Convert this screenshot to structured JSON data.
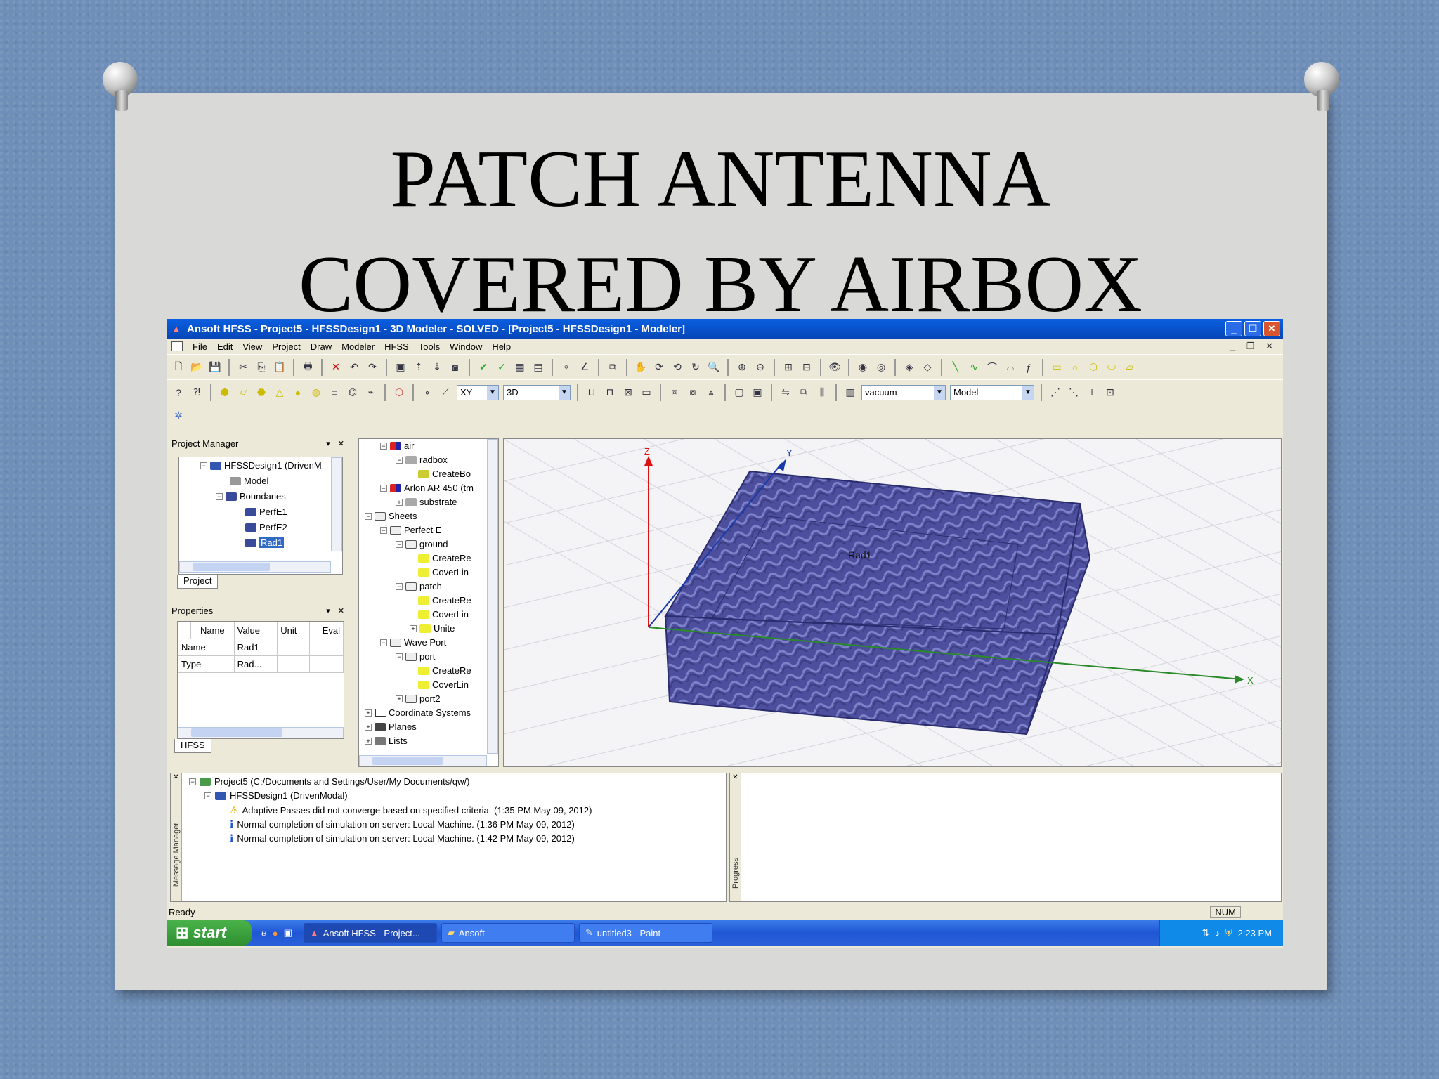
{
  "slide": {
    "title_line1": "PATCH ANTENNA",
    "title_line2": "COVERED BY AIRBOX"
  },
  "window": {
    "title": "Ansoft HFSS - Project5 - HFSSDesign1 - 3D Modeler - SOLVED - [Project5 - HFSSDesign1 - Modeler]",
    "minimize": "_",
    "maximize": "❐",
    "close": "✕"
  },
  "menu": [
    "File",
    "Edit",
    "View",
    "Project",
    "Draw",
    "Modeler",
    "HFSS",
    "Tools",
    "Window",
    "Help"
  ],
  "toolbar": {
    "plane_select": "XY",
    "dim_select": "3D",
    "material_select": "vacuum",
    "model_select": "Model"
  },
  "project_manager": {
    "header": "Project Manager",
    "items": [
      {
        "label": "HFSSDesign1 (DrivenM"
      },
      {
        "label": "Model"
      },
      {
        "label": "Boundaries"
      },
      {
        "label": "PerfE1"
      },
      {
        "label": "PerfE2"
      },
      {
        "label": "Rad1"
      }
    ],
    "tab": "Project"
  },
  "properties": {
    "header": "Properties",
    "columns": [
      "Name",
      "Value",
      "Unit",
      "Eval"
    ],
    "rows": [
      [
        "Name",
        "Rad1",
        "",
        ""
      ],
      [
        "Type",
        "Rad...",
        "",
        ""
      ]
    ],
    "tab": "HFSS"
  },
  "model_tree": {
    "items": [
      {
        "label": "air"
      },
      {
        "label": "radbox"
      },
      {
        "label": "CreateBo"
      },
      {
        "label": "Arlon AR 450 (tm"
      },
      {
        "label": "substrate"
      },
      {
        "label": "Sheets"
      },
      {
        "label": "Perfect E"
      },
      {
        "label": "ground"
      },
      {
        "label": "CreateRe"
      },
      {
        "label": "CoverLin"
      },
      {
        "label": "patch"
      },
      {
        "label": "CreateRe"
      },
      {
        "label": "CoverLin"
      },
      {
        "label": "Unite"
      },
      {
        "label": "Wave Port"
      },
      {
        "label": "port"
      },
      {
        "label": "CreateRe"
      },
      {
        "label": "CoverLin"
      },
      {
        "label": "port2"
      },
      {
        "label": "Coordinate Systems"
      },
      {
        "label": "Planes"
      },
      {
        "label": "Lists"
      }
    ]
  },
  "viewport": {
    "axis_z": "Z",
    "axis_y": "Y",
    "axis_x": "X",
    "object_label": "Rad1",
    "box_color": "#4a4e9c"
  },
  "message_manager": {
    "side_label": "Message Manager",
    "project_line": "Project5 (C:/Documents and Settings/User/My Documents/qw/)",
    "design_line": "HFSSDesign1 (DrivenModal)",
    "messages": [
      {
        "icon": "warning-icon",
        "text": "Adaptive Passes did not converge based on specified criteria. (1:35 PM  May 09, 2012)"
      },
      {
        "icon": "info-icon",
        "text": "Normal completion of simulation on server: Local Machine. (1:36 PM  May 09, 2012)"
      },
      {
        "icon": "info-icon",
        "text": "Normal completion of simulation on server: Local Machine. (1:42 PM  May 09, 2012)"
      }
    ]
  },
  "progress": {
    "side_label": "Progress"
  },
  "status": {
    "ready": "Ready",
    "num": "NUM"
  },
  "taskbar": {
    "start": "start",
    "tasks": [
      "Ansoft HFSS - Project...",
      "Ansoft",
      "untitled3 - Paint"
    ],
    "clock": "2:23 PM"
  }
}
